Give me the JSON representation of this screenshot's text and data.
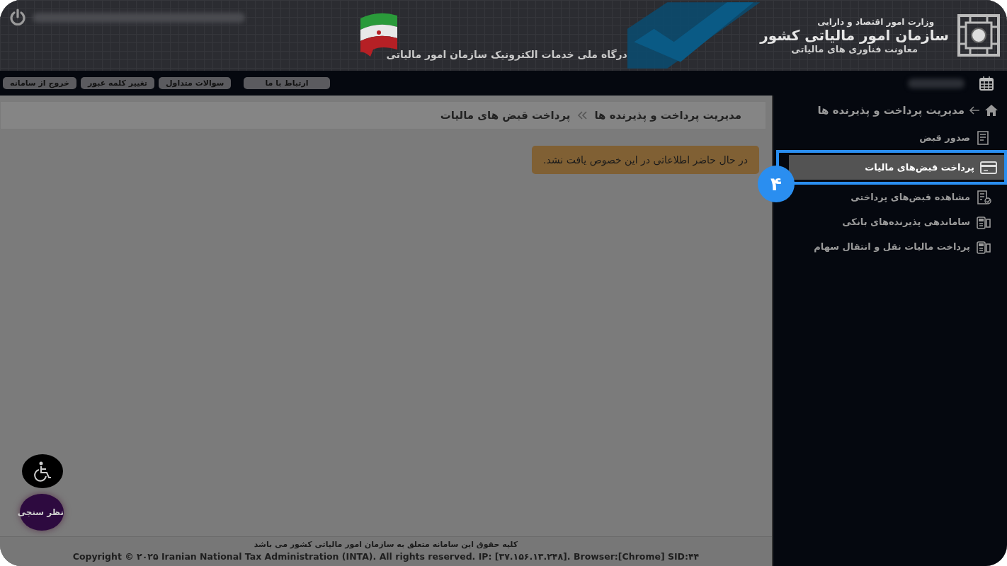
{
  "header": {
    "org_small": "وزارت امور اقتصاد و دارایی",
    "org_title": "سازمان امور مالیاتی کشور",
    "org_sub": "معاونت فناوری های مالیاتی",
    "portal_title": "درگاه ملی خدمات الکترونیک سازمان امور مالیاتی"
  },
  "toolbar": {
    "buttons": [
      "ارتباط با ما",
      "سوالات متداول",
      "تغییر کلمه عبور",
      "خروج از سامانه"
    ]
  },
  "sidebar": {
    "heading": "مدیریت پرداخت و پذیرنده ها",
    "items": [
      {
        "label": "صدور قبض",
        "kind": "receipt",
        "selected": false
      },
      {
        "label": "پرداخت قبض‌های مالیات",
        "kind": "card",
        "selected": true
      },
      {
        "label": "مشاهده قبض‌های پرداختی",
        "kind": "checklist",
        "selected": false
      },
      {
        "label": "ساماندهی پذیرنده‌های بانکی",
        "kind": "pos",
        "selected": false
      },
      {
        "label": "پرداخت مالیات نقل و انتقال سهام",
        "kind": "pos",
        "selected": false
      }
    ]
  },
  "breadcrumb": [
    "مدیریت پرداخت و پذیرنده ها",
    "پرداخت قبض های مالیات"
  ],
  "alert": "در حال حاضر اطلاعاتی در این خصوص یافت نشد.",
  "float_buttons": {
    "survey": "نظر سنجی"
  },
  "footer": {
    "rights": "کلیه حقوق این سامانه متعلق به سازمان امور مالیاتی کشور می باشد",
    "copyright": "Copyright © ۲۰۲۵ Iranian National Tax Administration (INTA). All rights reserved. IP: [۳۷.۱۵۶.۱۳.۲۴۸]. Browser:[Chrome] SID:۴۴"
  },
  "annotation": {
    "step": "۴"
  }
}
